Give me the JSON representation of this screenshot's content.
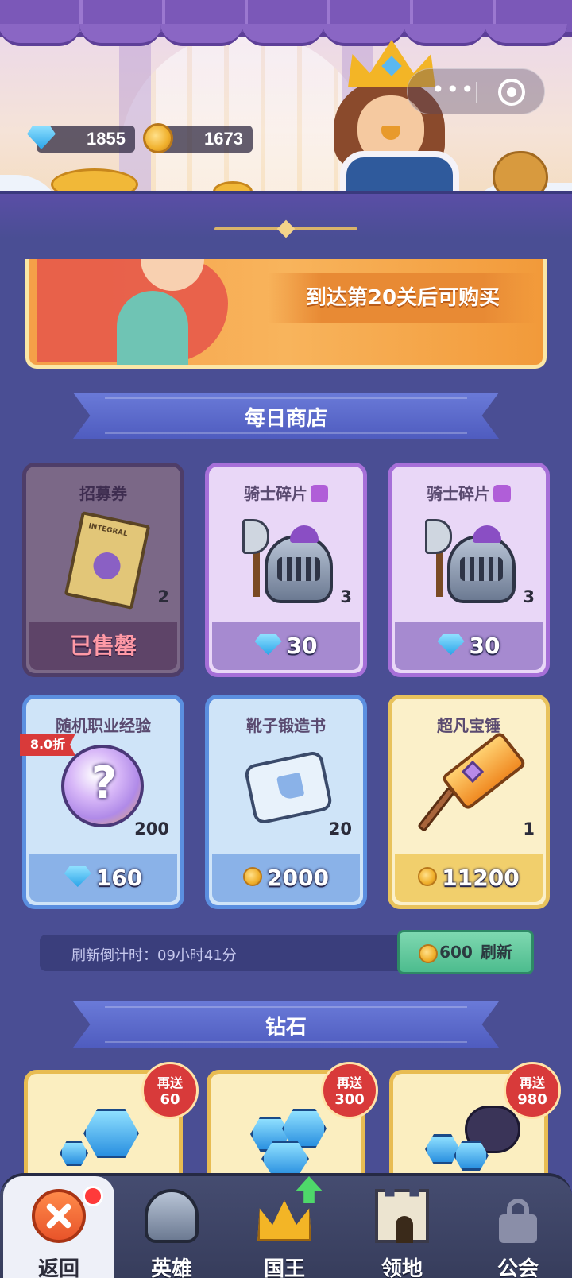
{
  "header": {
    "currencies": [
      {
        "icon": "diamond-icon",
        "value": "1855"
      },
      {
        "icon": "coin-icon",
        "value": "1673"
      }
    ],
    "capsule_more": "•••"
  },
  "banner": {
    "text": "到达第20关后可购买"
  },
  "daily_shop": {
    "title": "每日商店",
    "items": [
      {
        "name": "招募券",
        "qty": "2",
        "price": "已售罄",
        "price_icon": "",
        "state": "sold"
      },
      {
        "name": "骑士碎片",
        "qty": "3",
        "price": "30",
        "price_icon": "diamond-icon",
        "name_icon": "puzzle-icon"
      },
      {
        "name": "骑士碎片",
        "qty": "3",
        "price": "30",
        "price_icon": "diamond-icon",
        "name_icon": "puzzle-icon"
      },
      {
        "name": "随机职业经验",
        "qty": "200",
        "price": "160",
        "price_icon": "diamond-icon",
        "discount": "8.0折"
      },
      {
        "name": "靴子锻造书",
        "qty": "20",
        "price": "2000",
        "price_icon": "coin-icon"
      },
      {
        "name": "超凡宝锤",
        "qty": "1",
        "price": "11200",
        "price_icon": "coin-icon"
      }
    ],
    "refresh": {
      "label": "刷新倒计时：09小时41分",
      "cost": "600",
      "button_label": "刷新"
    }
  },
  "diamond_shop": {
    "title": "钻石",
    "packs": [
      {
        "bonus_label": "再送",
        "bonus": "60"
      },
      {
        "bonus_label": "再送",
        "bonus": "300"
      },
      {
        "bonus_label": "再送",
        "bonus": "980"
      }
    ]
  },
  "bottom_nav": {
    "items": [
      {
        "label": "返回",
        "icon": "close-icon",
        "active": true,
        "badge": "red-dot"
      },
      {
        "label": "英雄",
        "icon": "helmet-icon"
      },
      {
        "label": "国王",
        "icon": "crown-icon",
        "badge": "arrow-up-icon"
      },
      {
        "label": "领地",
        "icon": "castle-icon"
      },
      {
        "label": "公会",
        "icon": "lock-icon"
      }
    ]
  },
  "colors": {
    "background": "#4a4e94",
    "diamond": "#2aa4e8",
    "coin": "#f0b02c",
    "sold_text": "#ff9aa6",
    "refresh_button": "#4dbc8e",
    "badge_red": "#d83a3a"
  }
}
